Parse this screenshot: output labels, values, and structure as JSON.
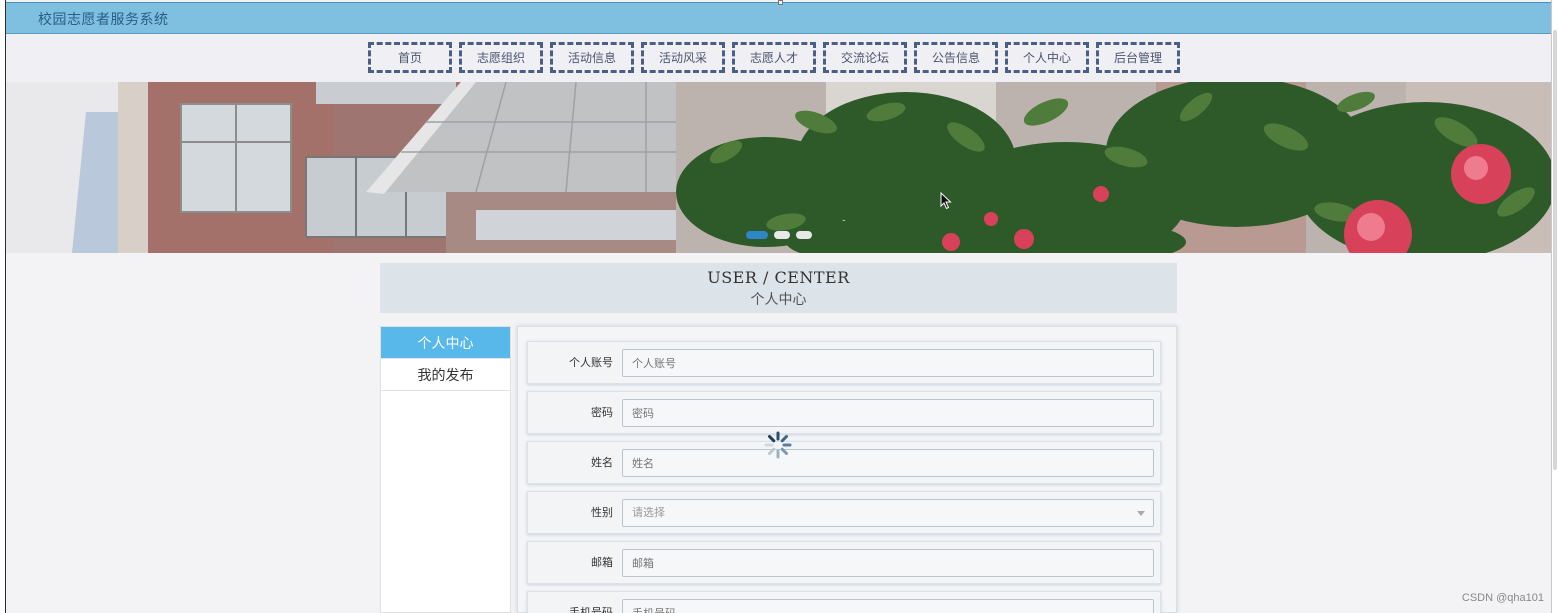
{
  "app": {
    "title": "校园志愿者服务系统"
  },
  "nav": {
    "items": [
      {
        "label": "首页"
      },
      {
        "label": "志愿组织"
      },
      {
        "label": "活动信息"
      },
      {
        "label": "活动风采"
      },
      {
        "label": "志愿人才"
      },
      {
        "label": "交流论坛"
      },
      {
        "label": "公告信息"
      },
      {
        "label": "个人中心"
      },
      {
        "label": "后台管理"
      }
    ]
  },
  "banner": {
    "slides_total": 3,
    "active_slide": 1
  },
  "center": {
    "title_en": "USER / CENTER",
    "title_cn": "个人中心"
  },
  "side_menu": {
    "items": [
      {
        "label": "个人中心",
        "active": true
      },
      {
        "label": "我的发布",
        "active": false
      }
    ]
  },
  "form": {
    "account": {
      "label": "个人账号",
      "placeholder": "个人账号"
    },
    "password": {
      "label": "密码",
      "placeholder": "密码"
    },
    "name": {
      "label": "姓名",
      "placeholder": "姓名"
    },
    "gender": {
      "label": "性别",
      "placeholder": "请选择"
    },
    "email": {
      "label": "邮箱",
      "placeholder": "邮箱"
    },
    "phone": {
      "label": "手机号码",
      "placeholder": "手机号码"
    }
  },
  "watermark": "CSDN @qha101",
  "colors": {
    "topbar": "#7fbfdf",
    "nav_border": "#4a5f86",
    "side_active": "#58b8ea",
    "slider_active": "#2f86c6"
  },
  "icons": {
    "loading": "loading-spinner-icon",
    "cursor": "mouse-cursor-icon"
  }
}
